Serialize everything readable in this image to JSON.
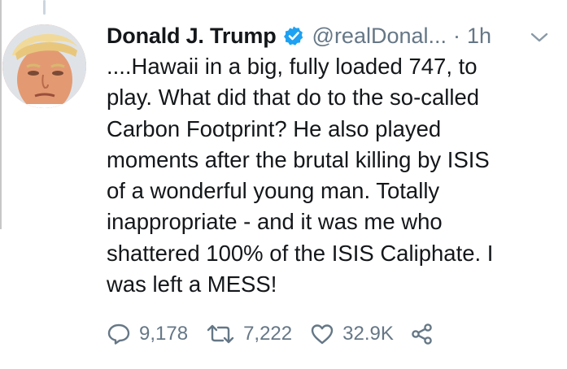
{
  "tweet": {
    "author_name": "Donald J. Trump",
    "handle": "@realDonal...",
    "separator": "·",
    "timestamp": "1h",
    "text_lines": [
      "....Hawaii in a big, fully loaded 747, to",
      "play. What did that do to the so-called",
      "Carbon Footprint? He also played",
      "moments after the brutal killing by ISIS",
      "of a wonderful young man. Totally",
      "inappropriate - and it was me who",
      "shattered 100% of the ISIS Caliphate. I",
      "was left a MESS!"
    ],
    "replies": "9,178",
    "retweets": "7,222",
    "likes": "32.9K"
  },
  "icons": {
    "verified": "verified-badge-icon",
    "menu": "chevron-down-icon",
    "reply": "reply-icon",
    "retweet": "retweet-icon",
    "like": "heart-icon",
    "share": "share-icon"
  },
  "colors": {
    "verified_blue": "#1da1f2",
    "secondary_text": "#657786",
    "primary_text": "#14171a"
  }
}
